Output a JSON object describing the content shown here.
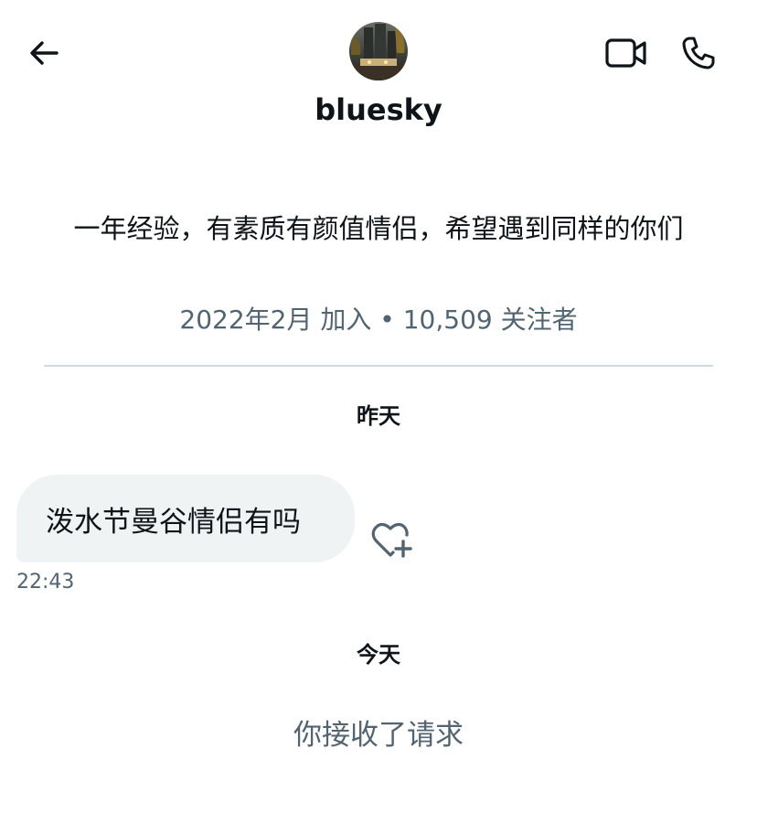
{
  "header": {
    "username": "bluesky",
    "icons": {
      "back": "arrow-left-icon",
      "video": "video-camera-icon",
      "phone": "phone-icon"
    }
  },
  "profile": {
    "bio": "一年经验，有素质有颜值情侣，希望遇到同样的你们",
    "joined": "2022年2月 加入",
    "separator": "•",
    "followers": "10,509 关注者"
  },
  "conversation": {
    "groups": [
      {
        "day": "昨天",
        "messages": [
          {
            "text": "泼水节曼谷情侣有吗",
            "time": "22:43"
          }
        ]
      },
      {
        "day": "今天",
        "status": "你接收了请求"
      }
    ]
  },
  "colors": {
    "text_primary": "#0f1419",
    "text_secondary": "#536471",
    "bubble_bg": "#eff3f4",
    "divider": "#cfd9de"
  }
}
